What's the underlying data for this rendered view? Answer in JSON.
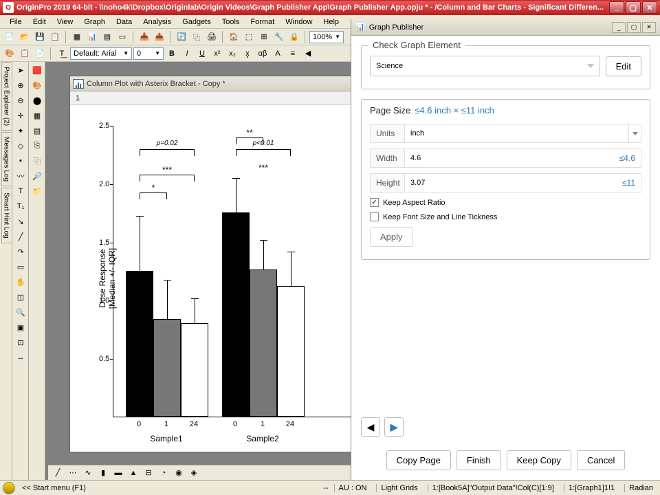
{
  "app": {
    "title": "OriginPro 2019 64-bit - \\\\noho4k\\Dropbox\\Originlab\\Origin Videos\\Graph Publisher App\\Graph Publisher App.opju * - /Column and Bar Charts - Significant Differen..."
  },
  "menus": [
    "File",
    "Edit",
    "View",
    "Graph",
    "Data",
    "Analysis",
    "Gadgets",
    "Tools",
    "Format",
    "Window",
    "Help"
  ],
  "toolbar": {
    "zoom": "100%",
    "font": "Default: Arial",
    "fontsize": "0"
  },
  "side_tabs": [
    "Project Explorer (2)",
    "Messages Log",
    "Smart Hint Log"
  ],
  "graph_window": {
    "title": "Column Plot with Asterix Bracket - Copy *",
    "pager": "1"
  },
  "chart_data": {
    "type": "bar",
    "ylabel": "Dose Response\n[Median +/- IQR]",
    "ylim": [
      0,
      2.5
    ],
    "yticks": [
      0.5,
      1.0,
      1.5,
      2.0,
      2.5
    ],
    "groups": [
      "Sample1",
      "Sample2"
    ],
    "categories": [
      "0",
      "1",
      "24"
    ],
    "series": [
      {
        "group": "Sample1",
        "values": [
          1.25,
          0.84,
          0.8
        ],
        "err_up": [
          0.48,
          0.34,
          0.22
        ],
        "err_down": [
          0,
          0,
          0
        ]
      },
      {
        "group": "Sample2",
        "values": [
          1.75,
          1.26,
          1.12
        ],
        "err_up": [
          0.3,
          0.26,
          0.3
        ],
        "err_down": [
          0,
          0,
          0
        ]
      }
    ],
    "annotations": [
      {
        "style": "p",
        "text": "p=0.02",
        "group": 0,
        "from": 0,
        "to": 2
      },
      {
        "style": "stars",
        "text": "***",
        "group": 0,
        "from": 0,
        "to": 2,
        "level": 1
      },
      {
        "style": "stars",
        "text": "*",
        "group": 0,
        "from": 0,
        "to": 1,
        "level": 2
      },
      {
        "style": "p",
        "text": "p<0.01",
        "group": 1,
        "from": 0,
        "to": 2
      },
      {
        "style": "stars-top",
        "text": "***",
        "group": 1,
        "from": 0,
        "to": 2,
        "level": 0
      },
      {
        "style": "stars",
        "text": "**",
        "group": 1,
        "from": 0,
        "to": 1,
        "level": 1
      }
    ]
  },
  "publisher": {
    "title": "Graph Publisher",
    "section_check": "Check Graph Element",
    "journal": "Science",
    "edit_btn": "Edit",
    "pagesize_label": "Page Size",
    "pagesize_limits": "≤4.6 inch × ≤11 inch",
    "units_label": "Units",
    "units_value": "inch",
    "width_label": "Width",
    "width_value": "4.6",
    "width_hint": "≤4.6",
    "height_label": "Height",
    "height_value": "3.07",
    "height_hint": "≤11",
    "keep_ratio": "Keep Aspect Ratio",
    "keep_font": "Keep Font Size and Line Tickness",
    "apply_btn": "Apply",
    "copy_page": "Copy Page",
    "finish": "Finish",
    "keep_copy": "Keep Copy",
    "cancel": "Cancel"
  },
  "status": {
    "start_menu": "<< Start menu (F1)",
    "au": "AU : ON",
    "grids": "Light Grids",
    "page_info": "1:[Book5A]\"Output Data\"!Col(C)[1:9]",
    "graph_info": "1:[Graph1]1!1",
    "angle": "Radian"
  }
}
